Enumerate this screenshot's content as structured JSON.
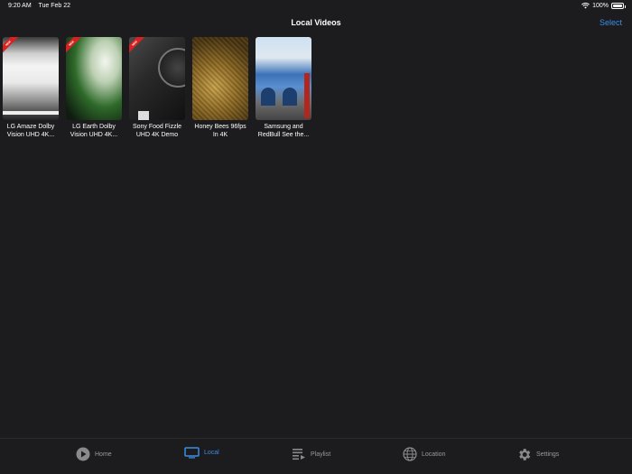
{
  "status": {
    "time": "9:20 AM",
    "date": "Tue Feb 22",
    "battery": "100%",
    "battery_level": 1.0
  },
  "nav": {
    "title": "Local Videos",
    "select_label": "Select"
  },
  "badge_text": "NEW",
  "videos": [
    {
      "title_line1": "LG Amaze Dolby",
      "title_line2": "Vision UHD 4K...",
      "is_new": true
    },
    {
      "title_line1": "LG Earth Dolby",
      "title_line2": "Vision UHD 4K...",
      "is_new": true
    },
    {
      "title_line1": "Sony Food Fizzle",
      "title_line2": "UHD 4K Demo",
      "is_new": true
    },
    {
      "title_line1": "Honey Bees 96fps",
      "title_line2": "In 4K",
      "is_new": false
    },
    {
      "title_line1": "Samsung and",
      "title_line2": "RedBull See the...",
      "is_new": false
    }
  ],
  "tabs": [
    {
      "label": "Home",
      "icon": "play-circle-icon",
      "active": false
    },
    {
      "label": "Local",
      "icon": "monitor-icon",
      "active": true
    },
    {
      "label": "Playlist",
      "icon": "playlist-icon",
      "active": false
    },
    {
      "label": "Location",
      "icon": "globe-icon",
      "active": false
    },
    {
      "label": "Settings",
      "icon": "gear-icon",
      "active": false
    }
  ],
  "colors": {
    "accent": "#3a8ee6",
    "background": "#1c1c1e",
    "inactive": "#9a9a9a",
    "badge": "#d92121"
  }
}
